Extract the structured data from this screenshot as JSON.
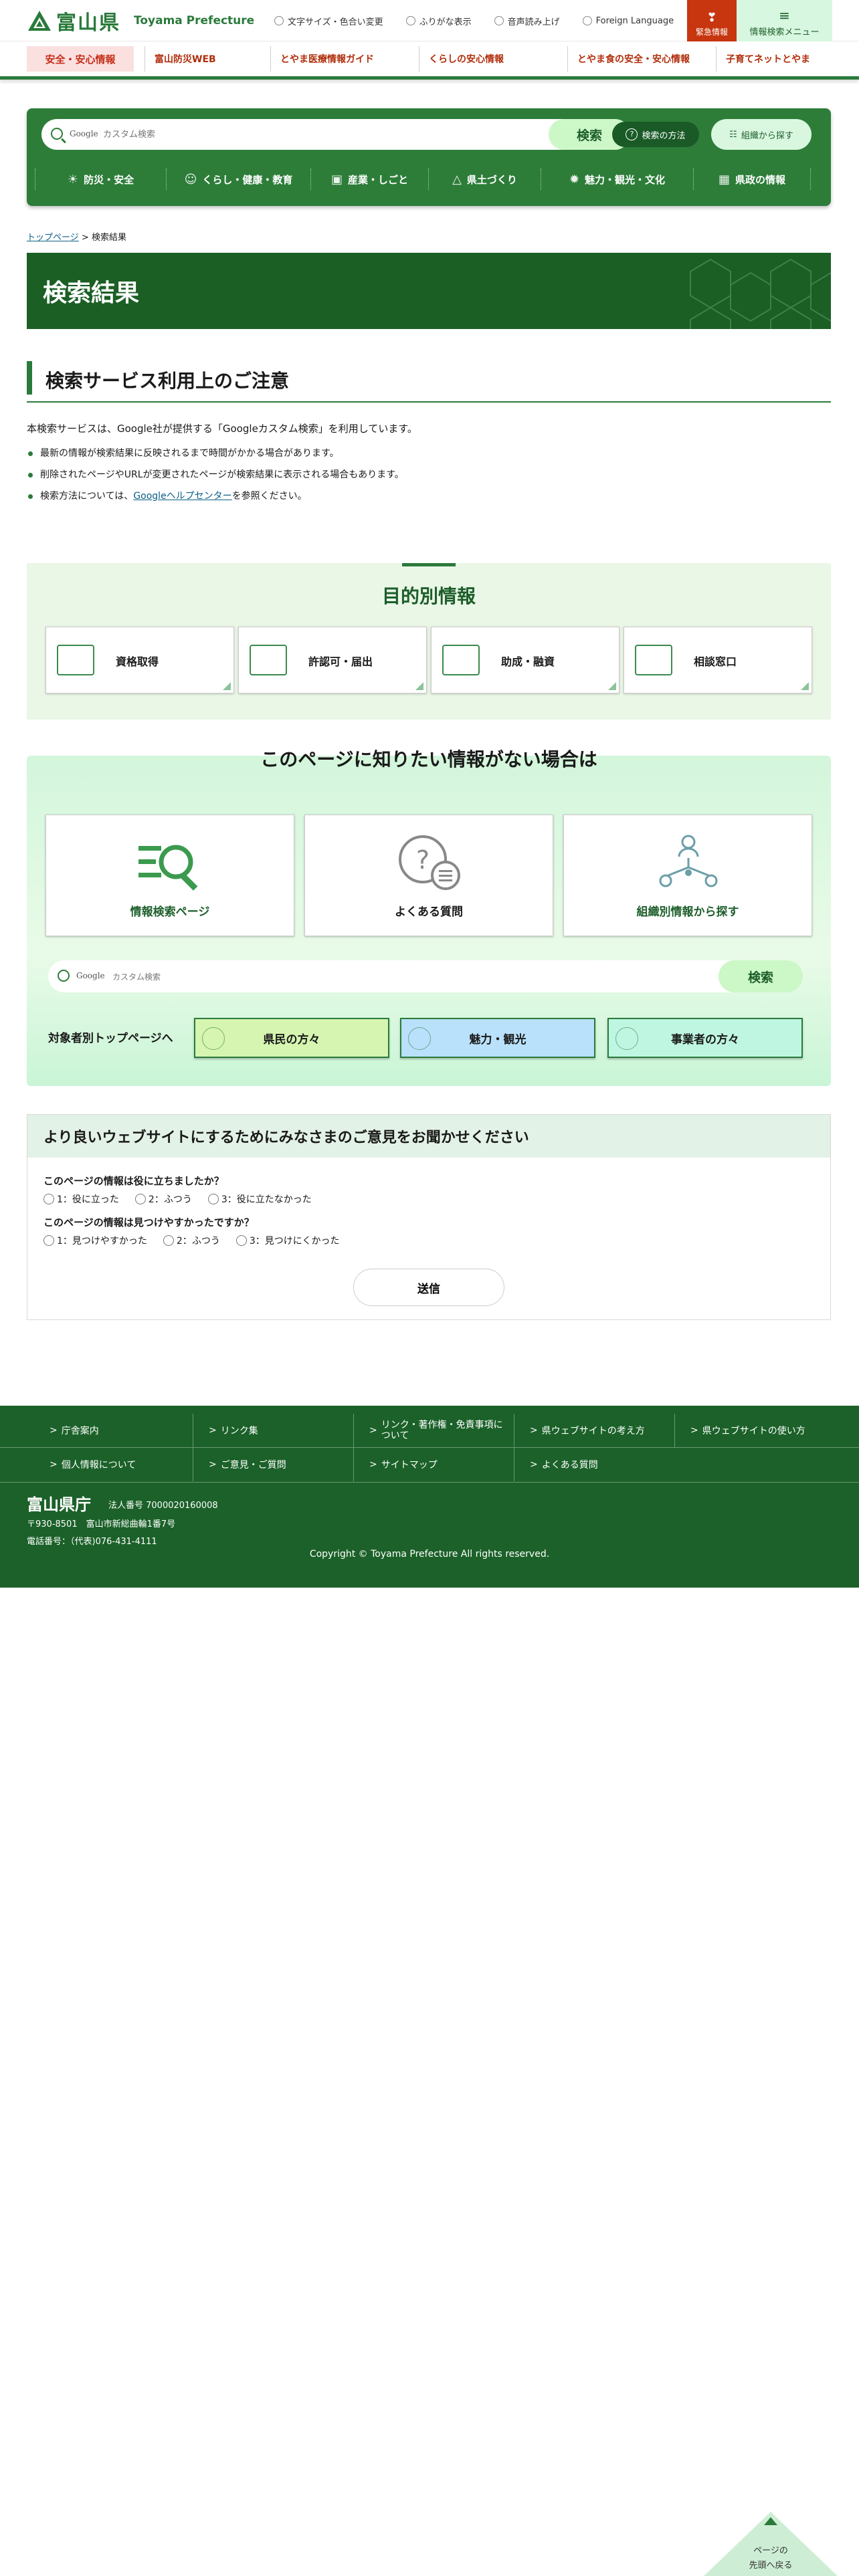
{
  "header": {
    "logo_ja": "富山県",
    "logo_en": "Toyama Prefecture",
    "utils": [
      "文字サイズ・色合い変更",
      "ふりがな表示",
      "音声読み上げ",
      "Foreign Language"
    ],
    "emergency": "緊急情報",
    "menu": "情報検索メニュー"
  },
  "topics": {
    "lead": "安全・安心情報",
    "links": [
      "富山防災WEB",
      "とやま医療情報ガイド",
      "くらしの安心情報",
      "とやま食の安全・安心情報",
      "子育てネットとやま"
    ]
  },
  "search": {
    "google": "Google",
    "placeholder": "カスタム検索",
    "button": "検索",
    "howto": "検索の方法",
    "org": "組織から探す"
  },
  "categories": [
    "防災・安全",
    "くらし・健康・教育",
    "産業・しごと",
    "県土づくり",
    "魅力・観光・文化",
    "県政の情報"
  ],
  "breadcrumb": {
    "home": "トップページ",
    "sep": ">",
    "current": "検索結果"
  },
  "page_title": "検索結果",
  "notice": {
    "heading": "検索サービス利用上のご注意",
    "intro": "本検索サービスは、Google社が提供する「Googleカスタム検索」を利用しています。",
    "items": [
      "最新の情報が検索結果に反映されるまで時間がかかる場合があります。",
      "削除されたページやURLが変更されたページが検索結果に表示される場合もあります。"
    ],
    "help_pre": "検索方法については、",
    "help_link": "Googleヘルプセンター",
    "help_post": "を参照ください。"
  },
  "purpose": {
    "title": "目的別情報",
    "cards": [
      "資格取得",
      "許認可・届出",
      "助成・融資",
      "相談窓口"
    ]
  },
  "not_found": {
    "title": "このページに知りたい情報がない場合は",
    "cards": [
      "情報検索ページ",
      "よくある質問",
      "組織別情報から探す"
    ],
    "search_google": "Google",
    "search_placeholder": "カスタム検索",
    "search_button": "検索",
    "target_label": "対象者別トップページへ",
    "targets": [
      "県民の方々",
      "魅力・観光",
      "事業者の方々"
    ],
    "target_colors": [
      "#d5f5b0",
      "#b9e1fb",
      "#bff6e2"
    ]
  },
  "feedback": {
    "heading": "より良いウェブサイトにするためにみなさまのご意見をお聞かせください",
    "q1": "このページの情報は役に立ちましたか？",
    "q1_opts": [
      "1：役に立った",
      "2：ふつう",
      "3：役に立たなかった"
    ],
    "q2": "このページの情報は見つけやすかったですか？",
    "q2_opts": [
      "1：見つけやすかった",
      "2：ふつう",
      "3：見つけにくかった"
    ],
    "send": "送信"
  },
  "footer": {
    "links_row1": [
      "庁舎案内",
      "リンク集",
      "リンク・著作権・免責事項について",
      "県ウェブサイトの考え方",
      "県ウェブサイトの使い方"
    ],
    "links_row2": [
      "個人情報について",
      "ご意見・ご質問",
      "サイトマップ",
      "よくある質問"
    ],
    "name": "富山県庁",
    "corp": "法人番号 7000020160008",
    "address": "〒930-8501　富山市新総曲輪1番7号",
    "tel": "電話番号：（代表)076-431-4111",
    "copyright": "Copyright © Toyama Prefecture All rights reserved."
  },
  "to_top": {
    "line1": "ページの",
    "line2": "先頭へ戻る"
  },
  "colors": {
    "brand_green": "#2a7a3b",
    "dark_green": "#1b5f25",
    "emergency_red": "#c7360f",
    "link_blue": "#0b5e86"
  }
}
